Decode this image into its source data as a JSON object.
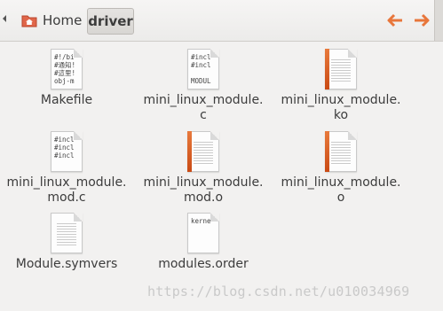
{
  "toolbar": {
    "breadcrumbs": [
      {
        "label": "Home"
      },
      {
        "label": "driver"
      }
    ],
    "back_icon": "left-arrow-icon",
    "forward_icon": "right-arrow-icon",
    "nav_color": "#e8763b"
  },
  "files": [
    {
      "name": "Makefile",
      "kind": "text",
      "preview": [
        "#!/bi",
        "#通知!",
        "#這里!",
        "obj-m"
      ]
    },
    {
      "name": "mini_linux_module.\nc",
      "kind": "text",
      "preview": [
        "#incl",
        "#incl",
        "",
        "MODUL"
      ]
    },
    {
      "name": "mini_linux_module.\nko",
      "kind": "binary",
      "preview": []
    },
    {
      "name": "mini_linux_module.\nmod.c",
      "kind": "text",
      "preview": [
        "#incl",
        "#incl",
        "#incl"
      ]
    },
    {
      "name": "mini_linux_module.\nmod.o",
      "kind": "binary",
      "preview": []
    },
    {
      "name": "mini_linux_module.\no",
      "kind": "binary",
      "preview": []
    },
    {
      "name": "Module.symvers",
      "kind": "plain",
      "preview": []
    },
    {
      "name": "modules.order",
      "kind": "text",
      "preview": [
        "kerne"
      ]
    }
  ],
  "watermark": "https://blog.csdn.net/u010034969"
}
